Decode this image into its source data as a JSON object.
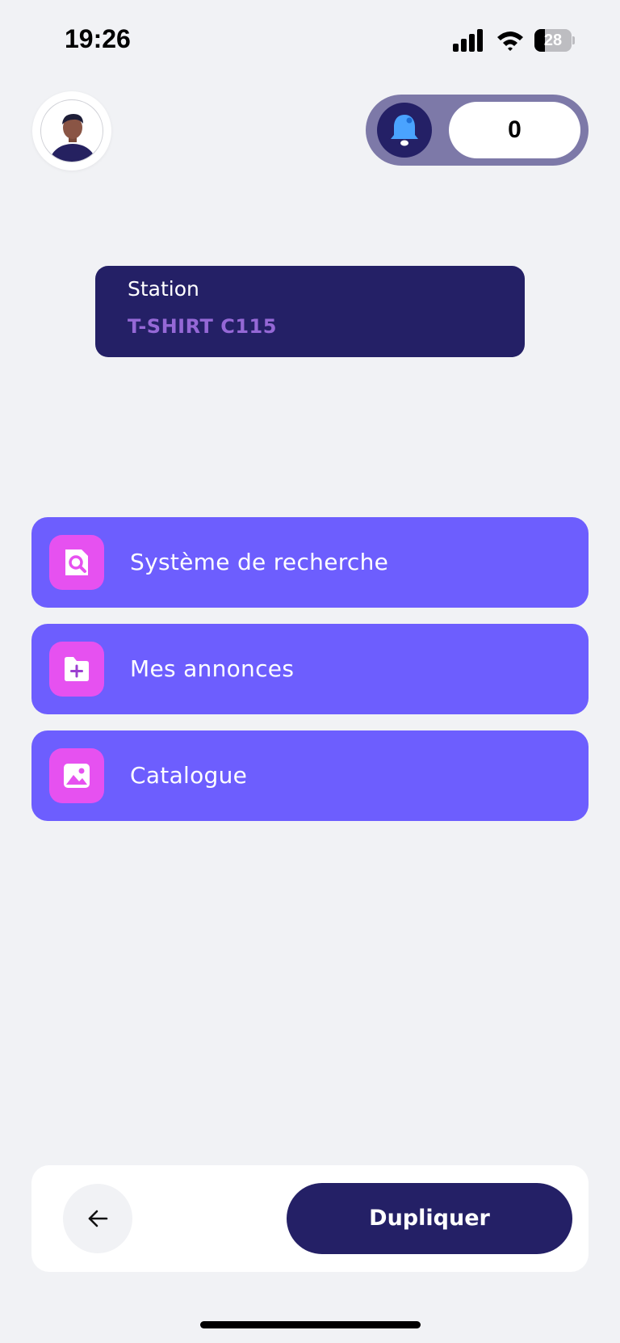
{
  "status_bar": {
    "time": "19:26",
    "battery_level": "28",
    "battery_fraction": 0.28,
    "icons": [
      "signal-icon",
      "wifi-icon",
      "battery-icon"
    ]
  },
  "header": {
    "avatar_icon": "user-avatar-icon",
    "notification_icon": "bell-icon",
    "notification_count": "0"
  },
  "station": {
    "label": "Station",
    "value": "T-SHIRT C115"
  },
  "menu": {
    "items": [
      {
        "label": "Système de recherche",
        "icon": "search-document-icon"
      },
      {
        "label": "Mes annonces",
        "icon": "folder-add-icon"
      },
      {
        "label": "Catalogue",
        "icon": "image-gallery-icon"
      }
    ]
  },
  "footer": {
    "back_icon": "arrow-left-icon",
    "duplicate_label": "Dupliquer"
  },
  "colors": {
    "background": "#f1f2f5",
    "primary_dark": "#242066",
    "menu_purple": "#6d5efe",
    "icon_pink": "#e651f0",
    "station_value": "#9568d6",
    "bell_blue": "#4aa3ff",
    "pill_gray_purple": "#7d79a8"
  }
}
